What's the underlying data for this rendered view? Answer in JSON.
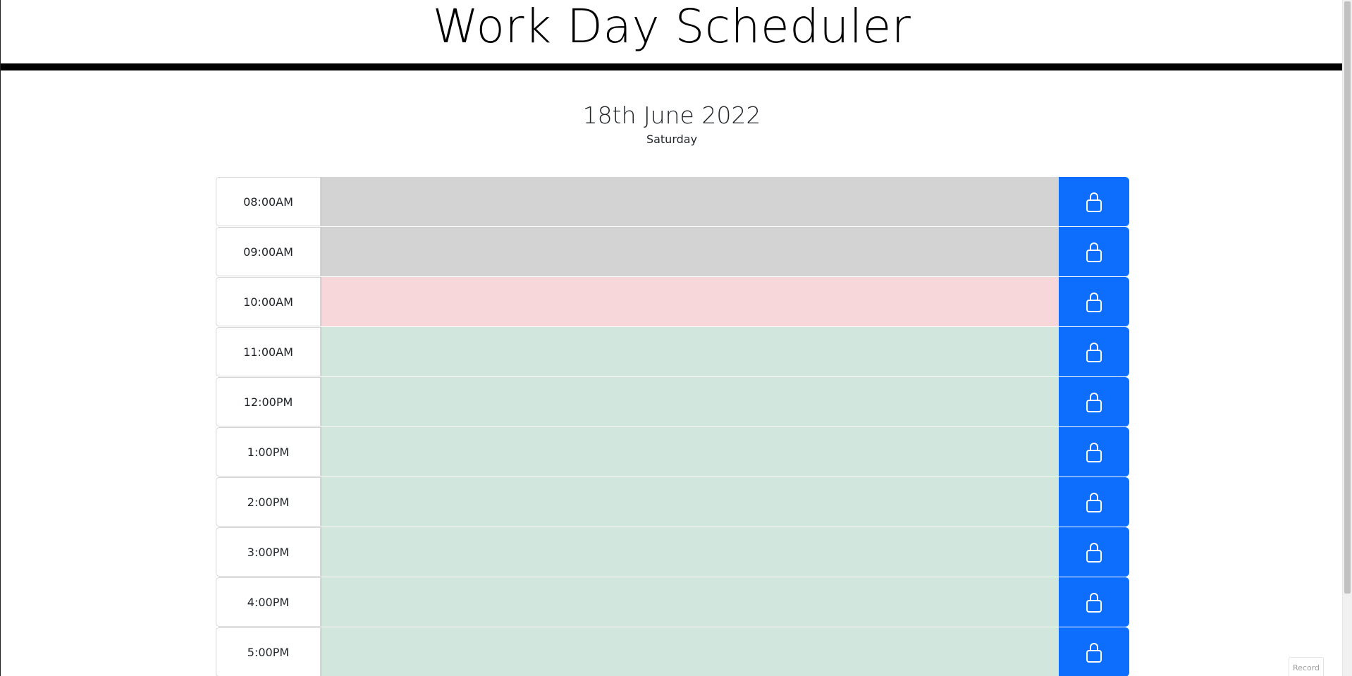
{
  "header": {
    "title": "Work Day Scheduler"
  },
  "date": {
    "main": "18th June 2022",
    "weekday": "Saturday"
  },
  "colors": {
    "past": "#d3d3d3",
    "present": "#f8d7da",
    "future": "#d1e7dd",
    "save_button": "#0d6efd"
  },
  "save_icon": "lock-icon",
  "rows": [
    {
      "time": "08:00AM",
      "status": "past",
      "text": ""
    },
    {
      "time": "09:00AM",
      "status": "past",
      "text": ""
    },
    {
      "time": "10:00AM",
      "status": "present",
      "text": ""
    },
    {
      "time": "11:00AM",
      "status": "future",
      "text": ""
    },
    {
      "time": "12:00PM",
      "status": "future",
      "text": ""
    },
    {
      "time": "1:00PM",
      "status": "future",
      "text": ""
    },
    {
      "time": "2:00PM",
      "status": "future",
      "text": ""
    },
    {
      "time": "3:00PM",
      "status": "future",
      "text": ""
    },
    {
      "time": "4:00PM",
      "status": "future",
      "text": ""
    },
    {
      "time": "5:00PM",
      "status": "future",
      "text": ""
    }
  ],
  "record_badge": "Record"
}
